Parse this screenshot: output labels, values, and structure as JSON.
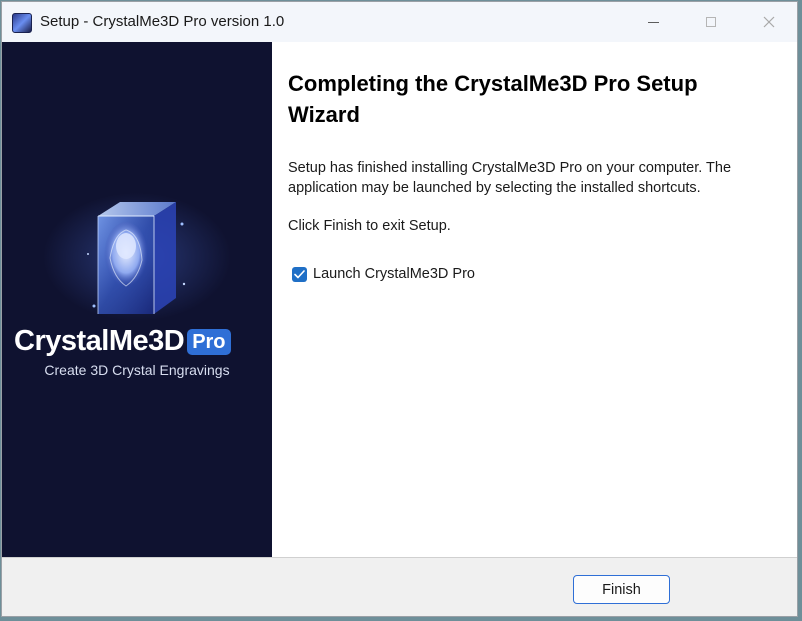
{
  "window": {
    "title": "Setup - CrystalMe3D Pro version 1.0",
    "icon": "app-icon",
    "controls": [
      "minimize-icon",
      "maximize-icon",
      "close-icon"
    ]
  },
  "sidebar": {
    "brand_name": "CrystalMe3D",
    "brand_badge": "Pro",
    "tagline": "Create 3D Crystal Engravings",
    "background_color": "#0f1230",
    "accent_color": "#2f6fd6"
  },
  "content": {
    "heading": "Completing the CrystalMe3D Pro Setup Wizard",
    "description": "Setup has finished installing CrystalMe3D Pro on your computer. The application may be launched by selecting the installed shortcuts.",
    "exit_instruction": "Click Finish to exit Setup.",
    "launch_option": {
      "label": "Launch CrystalMe3D Pro",
      "checked": true
    }
  },
  "footer": {
    "finish_label": "Finish"
  }
}
